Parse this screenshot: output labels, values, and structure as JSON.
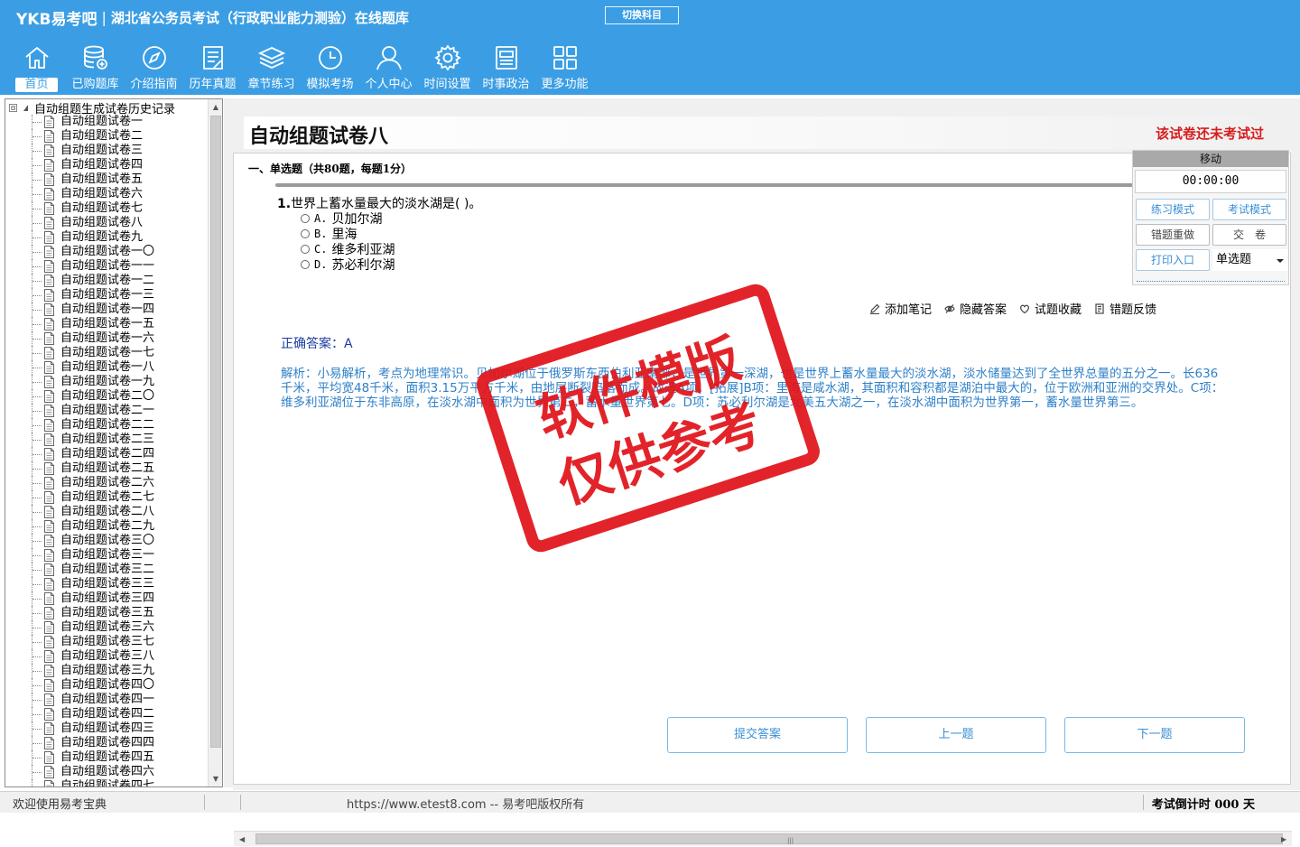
{
  "header": {
    "logo": "YKB易考吧",
    "separator": "|",
    "app_title": "湖北省公务员考试（行政职业能力测验）在线题库",
    "switch_subject": "切换科目"
  },
  "nav": [
    {
      "label": "首页",
      "icon": "home-icon"
    },
    {
      "label": "已购题库",
      "icon": "database-icon"
    },
    {
      "label": "介绍指南",
      "icon": "compass-icon"
    },
    {
      "label": "历年真题",
      "icon": "document-list-icon"
    },
    {
      "label": "章节练习",
      "icon": "layers-icon"
    },
    {
      "label": "模拟考场",
      "icon": "clock-icon"
    },
    {
      "label": "个人中心",
      "icon": "user-icon"
    },
    {
      "label": "时间设置",
      "icon": "gear-icon"
    },
    {
      "label": "时事政治",
      "icon": "newspaper-icon"
    },
    {
      "label": "更多功能",
      "icon": "grid-icon"
    }
  ],
  "tree": {
    "root_expander": "⊟",
    "root_label": "自动组题生成试卷历史记录",
    "items": [
      "自动组题试卷一",
      "自动组题试卷二",
      "自动组题试卷三",
      "自动组题试卷四",
      "自动组题试卷五",
      "自动组题试卷六",
      "自动组题试卷七",
      "自动组题试卷八",
      "自动组题试卷九",
      "自动组题试卷一〇",
      "自动组题试卷一一",
      "自动组题试卷一二",
      "自动组题试卷一三",
      "自动组题试卷一四",
      "自动组题试卷一五",
      "自动组题试卷一六",
      "自动组题试卷一七",
      "自动组题试卷一八",
      "自动组题试卷一九",
      "自动组题试卷二〇",
      "自动组题试卷二一",
      "自动组题试卷二二",
      "自动组题试卷二三",
      "自动组题试卷二四",
      "自动组题试卷二五",
      "自动组题试卷二六",
      "自动组题试卷二七",
      "自动组题试卷二八",
      "自动组题试卷二九",
      "自动组题试卷三〇",
      "自动组题试卷三一",
      "自动组题试卷三二",
      "自动组题试卷三三",
      "自动组题试卷三四",
      "自动组题试卷三五",
      "自动组题试卷三六",
      "自动组题试卷三七",
      "自动组题试卷三八",
      "自动组题试卷三九",
      "自动组题试卷四〇",
      "自动组题试卷四一",
      "自动组题试卷四二",
      "自动组题试卷四三",
      "自动组题试卷四四",
      "自动组题试卷四五",
      "自动组题试卷四六",
      "自动组题试卷四七"
    ]
  },
  "main": {
    "paper_title": "自动组题试卷八",
    "status": "该试卷还未考试过",
    "section_title": "一、单选题（共80题，每题1分）",
    "question": {
      "number": "1.",
      "text": "世界上蓄水量最大的淡水湖是( )。",
      "options": [
        {
          "key": "A.",
          "text": "贝加尔湖"
        },
        {
          "key": "B.",
          "text": "里海"
        },
        {
          "key": "C.",
          "text": "维多利亚湖"
        },
        {
          "key": "D.",
          "text": "苏必利尔湖"
        }
      ]
    },
    "tools": [
      {
        "label": "添加笔记",
        "icon": "pencil-icon"
      },
      {
        "label": "隐藏答案",
        "icon": "eye-off-icon"
      },
      {
        "label": "试题收藏",
        "icon": "heart-icon"
      },
      {
        "label": "错题反馈",
        "icon": "feedback-icon"
      }
    ],
    "answer_label": "正确答案：",
    "answer_value": "A",
    "analysis": "解析：小易解析，考点为地理常识。贝加尔湖位于俄罗斯东西伯利亚南部，是世界第一深湖，也是世界上蓄水量最大的淡水湖，淡水储量达到了全世界总量的五分之一。长636千米，平均宽48千米，面积3.15万平方千米，由地层断裂陷落而成。故选A项。[拓展]B项：里海是咸水湖，其面积和容积都是湖泊中最大的，位于欧洲和亚洲的交界处。C项：维多利亚湖位于东非高原，在淡水湖中面积为世界第二，蓄水量世界第七。D项：苏必利尔湖是北美五大湖之一，在淡水湖中面积为世界第一，蓄水量世界第三。",
    "buttons": {
      "submit": "提交答案",
      "prev": "上一题",
      "next": "下一题"
    }
  },
  "float_panel": {
    "title": "移动",
    "timer": "00:00:00",
    "practice_mode": "练习模式",
    "exam_mode": "考试模式",
    "redo_wrong": "错题重做",
    "submit_paper": "交　卷",
    "print": "打印入口",
    "question_type": "单选题"
  },
  "statusbar": {
    "welcome": "欢迎使用易考宝典",
    "copyright": "https://www.etest8.com -- 易考吧版权所有",
    "countdown": "考试倒计时 000 天"
  },
  "watermark": {
    "line1": "软件模版",
    "line2": "仅供参考"
  },
  "colors": {
    "header_bg": "#3b9ee4",
    "status_red": "#d61d1d",
    "answer_blue": "#1a3c9e",
    "analysis_blue": "#2f80c8",
    "stamp_red": "#e0141a"
  }
}
